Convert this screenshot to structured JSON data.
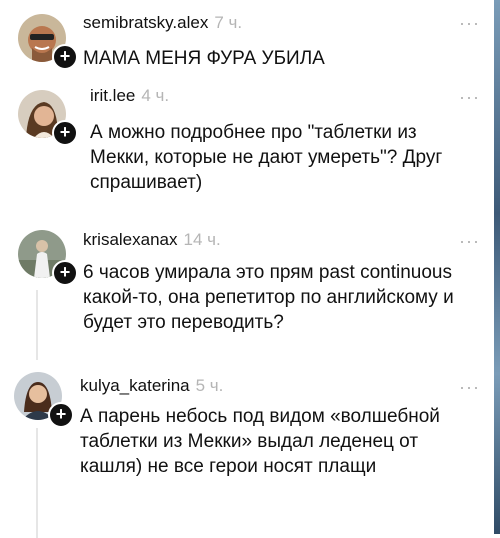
{
  "comments": [
    {
      "username": "semibratsky.alex",
      "time": "7 ч.",
      "text": "МАМА МЕНЯ ФУРА УБИЛА",
      "more": "···",
      "avatar_icon": "avatar-man-sunglasses",
      "badge": "+"
    },
    {
      "username": "irit.lee",
      "time": "4 ч.",
      "text": "А можно подробнее про \"таблетки из Мекки, которые не дают умереть\"? Друг спрашивает)",
      "more": "···",
      "avatar_icon": "avatar-woman-portrait",
      "badge": "+"
    },
    {
      "username": "krisalexanax",
      "time": "14 ч.",
      "text": "6 часов умирала это прям past continuous какой-то, она репетитор по английскому и будет это переводить?",
      "more": "···",
      "avatar_icon": "avatar-woman-outdoor",
      "badge": "+"
    },
    {
      "username": "kulya_katerina",
      "time": "5 ч.",
      "text": "А парень небось под видом «волшебной таблетки из Мекки» выдал леденец от кашля) не все герои носят плащи",
      "more": "···",
      "avatar_icon": "avatar-woman-smiling",
      "badge": "+"
    }
  ]
}
